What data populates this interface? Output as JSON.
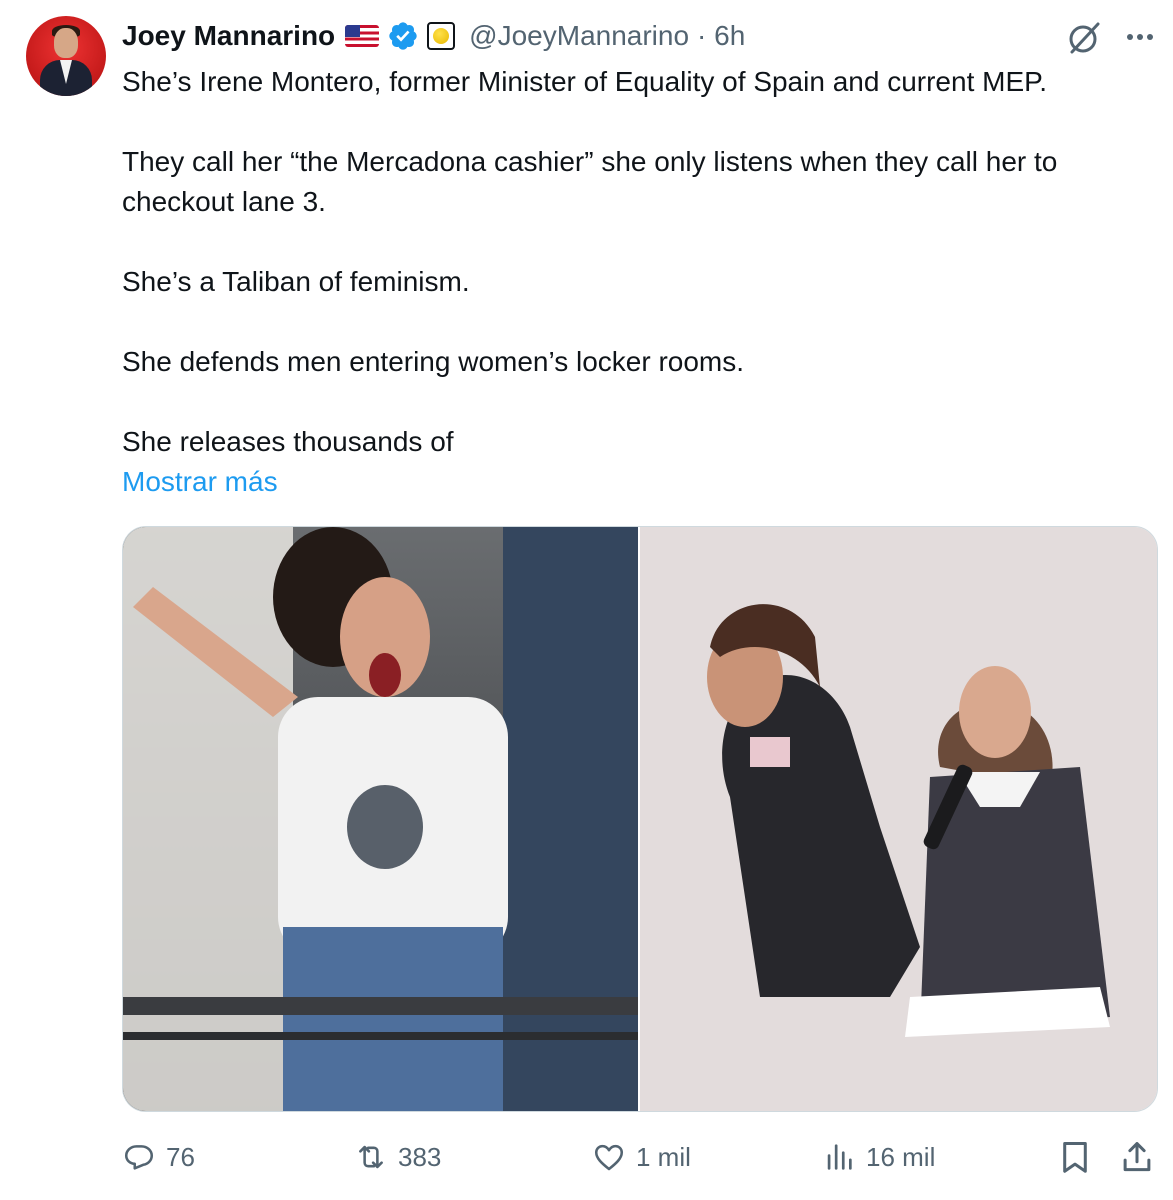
{
  "author": {
    "name": "Joey Mannarino",
    "handle": "@JoeyMannarino",
    "time": "· 6h",
    "flag_icon": "us-flag-icon",
    "verified_icon": "verified-badge-icon",
    "affiliate_icon": "gold-badge-icon"
  },
  "tweet": {
    "paragraphs": [
      "She’s Irene Montero, former Minister of Equality of Spain and current MEP.",
      "They call her “the Mercadona cashier” she only listens when they call her to checkout lane 3.",
      "She’s a Taliban of feminism.",
      "She defends men entering women’s locker rooms.",
      "She releases thousands of"
    ],
    "show_more": "Mostrar más"
  },
  "actions": {
    "replies": "76",
    "reposts": "383",
    "likes": "1 mil",
    "views": "16 mil"
  },
  "colors": {
    "text": "#0f1419",
    "secondary": "#536471",
    "link": "#1d9bf0",
    "verified": "#1d9bf0"
  }
}
